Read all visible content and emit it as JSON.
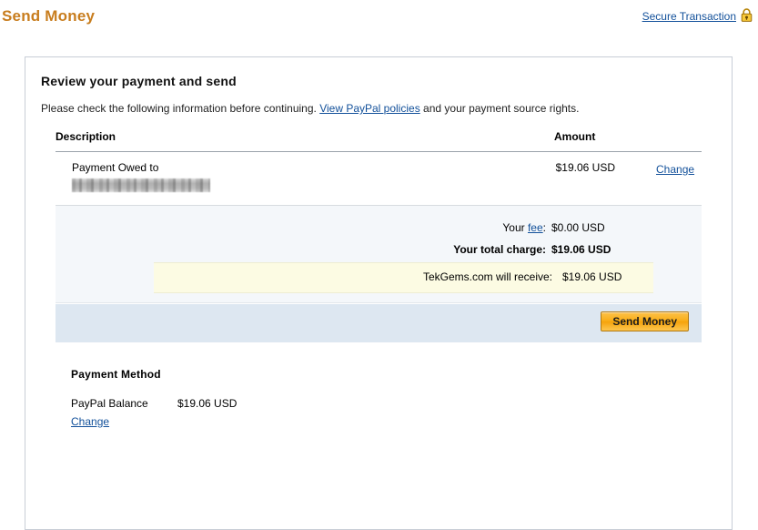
{
  "header": {
    "title": "Send Money",
    "secure_label": "Secure Transaction",
    "lock_icon": "padlock-icon",
    "title_color": "#c87d1e",
    "link_color": "#12509a"
  },
  "panel": {
    "heading": "Review your payment and send",
    "instruction_before": "Please check the following information before continuing. ",
    "policies_link": "View PayPal policies",
    "instruction_after": " and your payment source rights."
  },
  "table": {
    "columns": {
      "description": "Description",
      "amount": "Amount"
    },
    "rows": [
      {
        "description": "Payment Owed to",
        "recipient_redacted": true,
        "amount": "$19.06 USD",
        "action_label": "Change"
      }
    ]
  },
  "summary": {
    "fee_label_before": "Your ",
    "fee_label_link": "fee",
    "fee_label_after": ":",
    "fee_value": "$0.00 USD",
    "total_label": "Your total charge:",
    "total_value": "$19.06 USD",
    "receive_label": "TekGems.com will receive:",
    "receive_value": "$19.06 USD",
    "receive_band_color": "#fcfbe3",
    "background_color": "#f4f7fa"
  },
  "actions": {
    "send_button": "Send Money",
    "strip_color": "#dde7f1",
    "button_color": "#f9ac16"
  },
  "payment_method": {
    "title": "Payment Method",
    "name": "PayPal Balance",
    "amount": "$19.06 USD",
    "change_label": "Change"
  }
}
